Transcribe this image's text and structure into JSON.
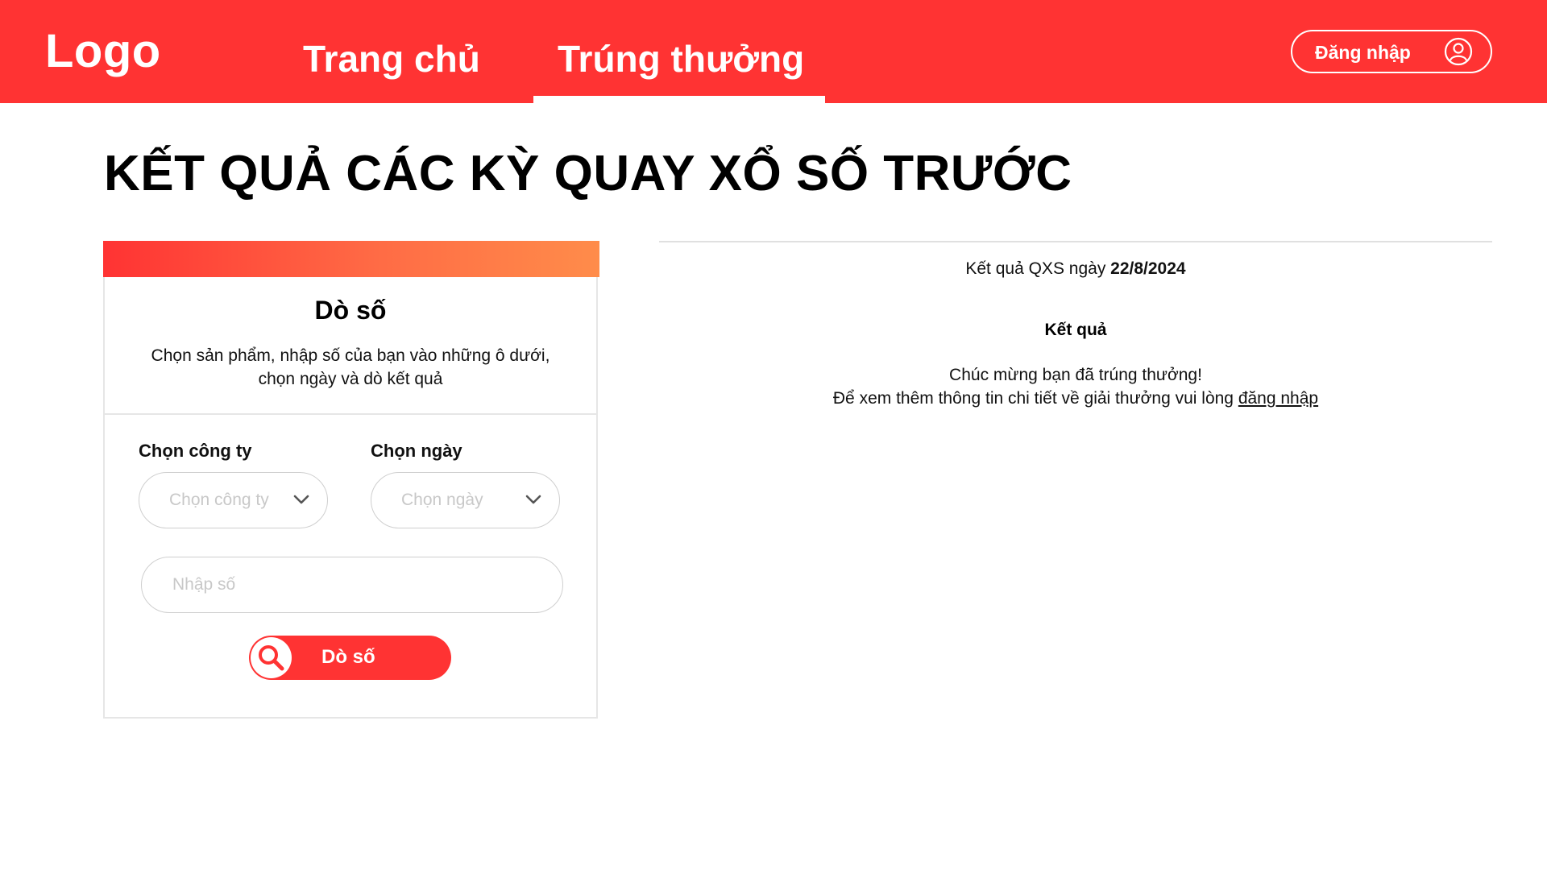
{
  "header": {
    "logo": "Logo",
    "nav": {
      "home": "Trang chủ",
      "prize": "Trúng thưởng"
    },
    "login_label": "Đăng nhập",
    "brand_color": "#ff3333",
    "login_icon": "user-circle-icon"
  },
  "page": {
    "title": "KẾT QUẢ CÁC KỲ QUAY XỔ SỐ TRƯỚC"
  },
  "search_panel": {
    "title": "Dò số",
    "description_line1": "Chọn sản phẩm, nhập số của bạn vào những ô dưới,",
    "description_line2": "chọn ngày và dò kết quả",
    "company_label": "Chọn công ty",
    "company_placeholder": "Chọn công ty",
    "date_label": "Chọn ngày",
    "date_placeholder": "Chọn ngày",
    "number_placeholder": "Nhập số",
    "button_label": "Dò số",
    "button_icon": "search-icon",
    "dropdown_icon": "chevron-down-icon"
  },
  "results": {
    "date_prefix": "Kết quả QXS ngày ",
    "date": "22/8/2024",
    "heading": "Kết quả",
    "message1": "Chúc mừng bạn đã trúng thưởng!",
    "message2_prefix": "Để xem thêm thông tin chi tiết về giải thưởng vui lòng ",
    "login_link": "đăng nhập"
  }
}
